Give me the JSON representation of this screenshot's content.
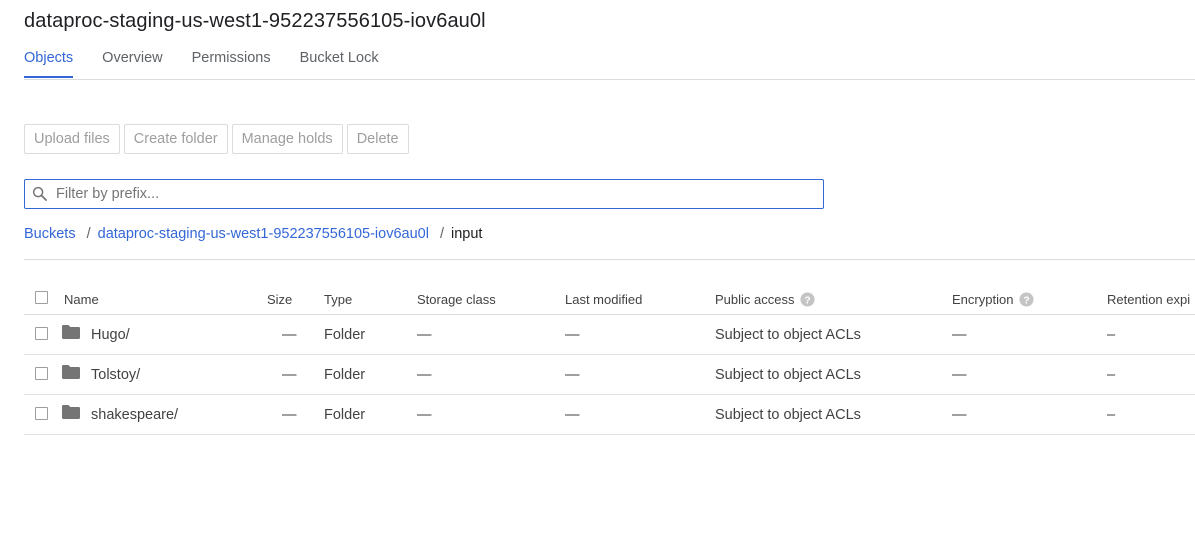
{
  "bucket": {
    "title": "dataproc-staging-us-west1-952237556105-iov6au0l"
  },
  "tabs": [
    "Objects",
    "Overview",
    "Permissions",
    "Bucket Lock"
  ],
  "toolbar": {
    "upload_label": "Upload files",
    "create_folder_label": "Create folder",
    "manage_holds_label": "Manage holds",
    "delete_label": "Delete"
  },
  "filter": {
    "placeholder": "Filter by prefix...",
    "value": ""
  },
  "breadcrumb": {
    "root": "Buckets",
    "bucket": "dataproc-staging-us-west1-952237556105-iov6au0l",
    "current": "input",
    "separator": "/"
  },
  "table": {
    "headers": {
      "name": "Name",
      "size": "Size",
      "type": "Type",
      "storage_class": "Storage class",
      "last_modified": "Last modified",
      "public_access": "Public access",
      "encryption": "Encryption",
      "retention": "Retention expi"
    },
    "rows": [
      {
        "name": "Hugo/",
        "size": "—",
        "type": "Folder",
        "storage_class": "—",
        "last_modified": "—",
        "public_access": "Subject to object ACLs",
        "encryption": "—",
        "retention": "–"
      },
      {
        "name": "Tolstoy/",
        "size": "—",
        "type": "Folder",
        "storage_class": "—",
        "last_modified": "—",
        "public_access": "Subject to object ACLs",
        "encryption": "—",
        "retention": "–"
      },
      {
        "name": "shakespeare/",
        "size": "—",
        "type": "Folder",
        "storage_class": "—",
        "last_modified": "—",
        "public_access": "Subject to object ACLs",
        "encryption": "—",
        "retention": "–"
      }
    ]
  },
  "colors": {
    "accent": "#3367d6",
    "folder_icon": "#757575",
    "disabled_text": "#9e9e9e"
  },
  "icons": {
    "search": "search-icon",
    "help": "help-icon",
    "folder": "folder-icon"
  }
}
